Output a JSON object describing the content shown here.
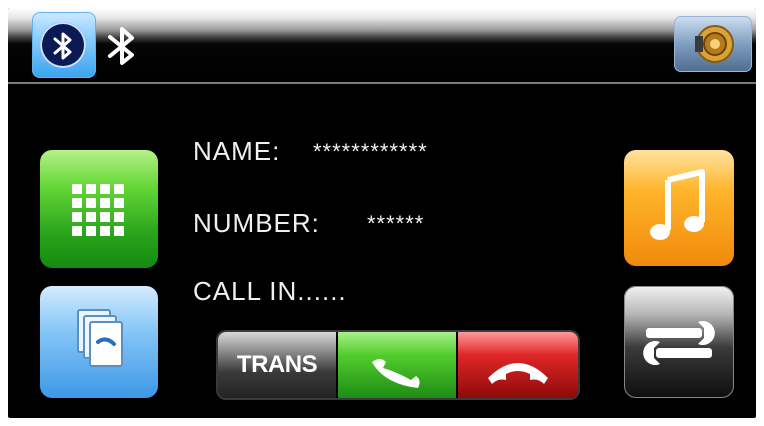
{
  "caller": {
    "name_label": "NAME:",
    "name_value": "************",
    "number_label": "NUMBER:",
    "number_value": "******",
    "status": "CALL IN......"
  },
  "call_bar": {
    "trans_label": "TRANS"
  },
  "icons": {
    "bluetooth_button": "bluetooth-icon",
    "bluetooth_status": "bluetooth-status-icon",
    "speaker": "speaker-icon",
    "keypad": "keypad-icon",
    "contacts": "contacts-icon",
    "music": "music-note-icon",
    "settings": "wrench-settings-icon",
    "answer": "answer-call-icon",
    "reject": "end-call-icon"
  },
  "colors": {
    "background": "#000000",
    "keypad_tile": "#2aa51c",
    "contacts_tile": "#3d98e6",
    "music_tile": "#f08a0c",
    "settings_tile": "#1a1a1a",
    "answer": "#1d8d16",
    "reject": "#c01818",
    "text": "#f0f0f0"
  }
}
